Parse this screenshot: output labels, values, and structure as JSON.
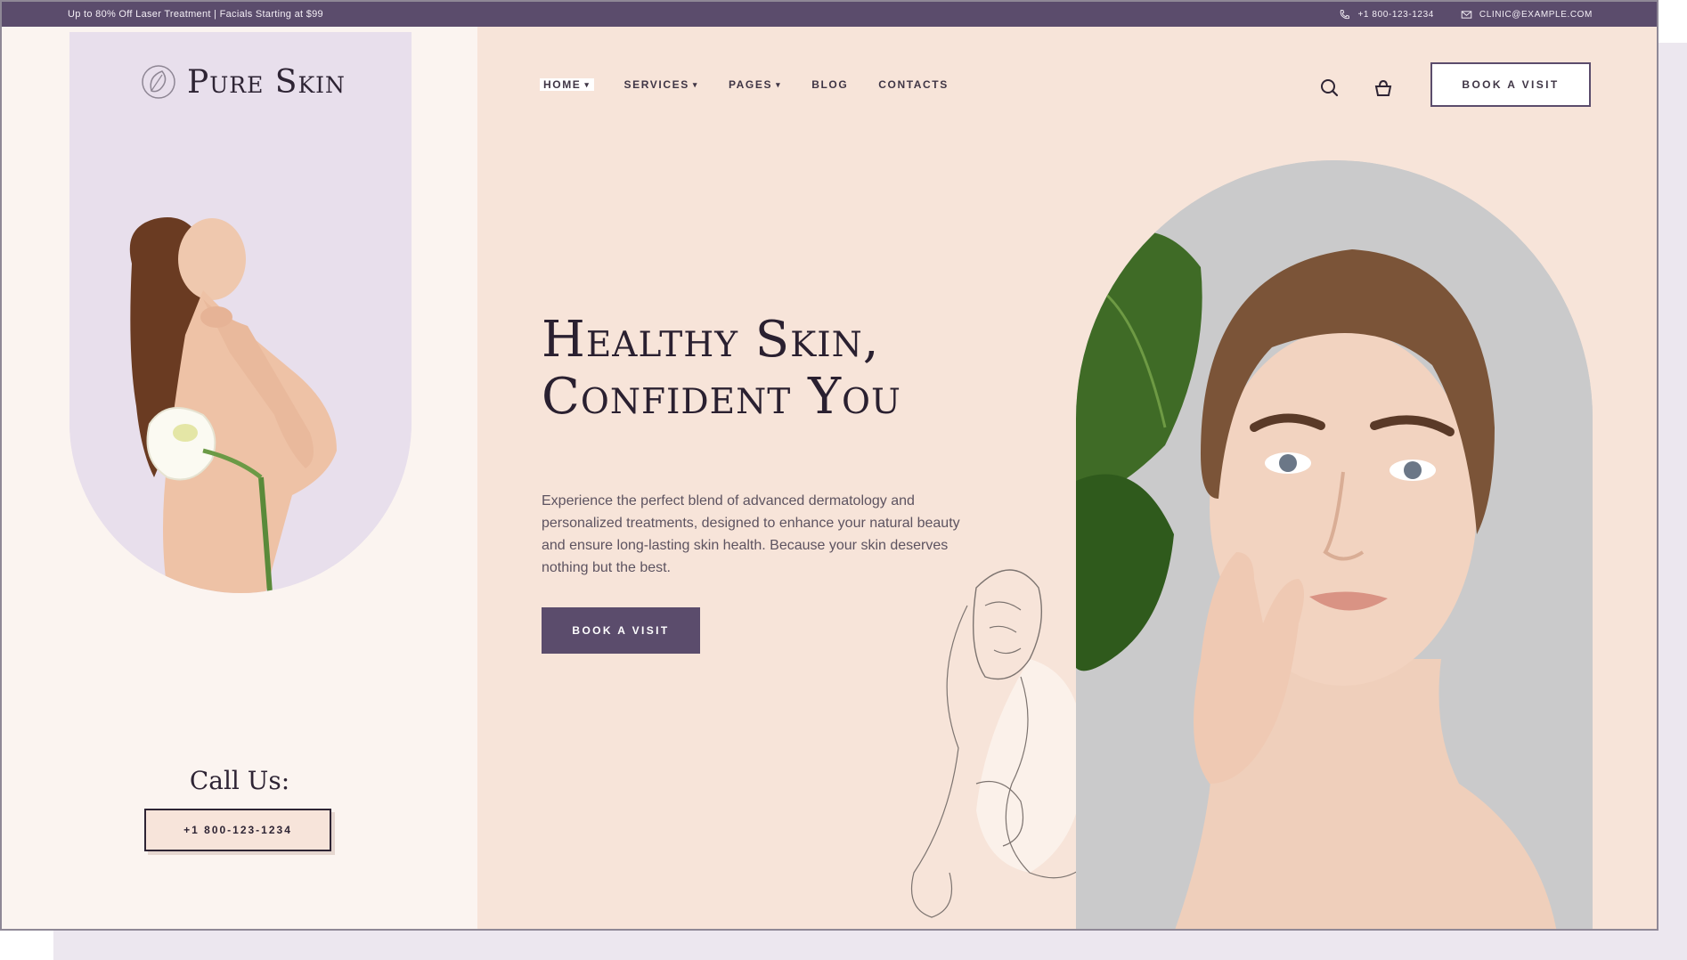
{
  "topbar": {
    "promo": "Up to 80% Off Laser Treatment | Facials Starting at $99",
    "phone": "+1 800-123-1234",
    "email": "CLINIC@EXAMPLE.COM"
  },
  "brand": {
    "name": "Pure Skin"
  },
  "nav": {
    "items": [
      {
        "label": "HOME",
        "caret": "▾"
      },
      {
        "label": "SERVICES",
        "caret": "▾"
      },
      {
        "label": "PAGES",
        "caret": "▾"
      },
      {
        "label": "BLOG",
        "caret": ""
      },
      {
        "label": "CONTACTS",
        "caret": ""
      }
    ],
    "book_label": "BOOK A VISIT"
  },
  "hero": {
    "headline_line1": "Healthy Skin,",
    "headline_line2": "Confident You",
    "description": "Experience the perfect blend of advanced dermatology and personalized treatments, designed to enhance your natural beauty and ensure long-lasting skin health. Because your skin deserves nothing but the best.",
    "cta_label": "BOOK A VISIT"
  },
  "contact": {
    "call_label": "Call Us:",
    "phone": "+1 800-123-1234"
  },
  "colors": {
    "accent": "#5b4c6c",
    "peach": "#f7e4d9",
    "lavender": "#e8dfec",
    "cream": "#fbf4f0"
  }
}
